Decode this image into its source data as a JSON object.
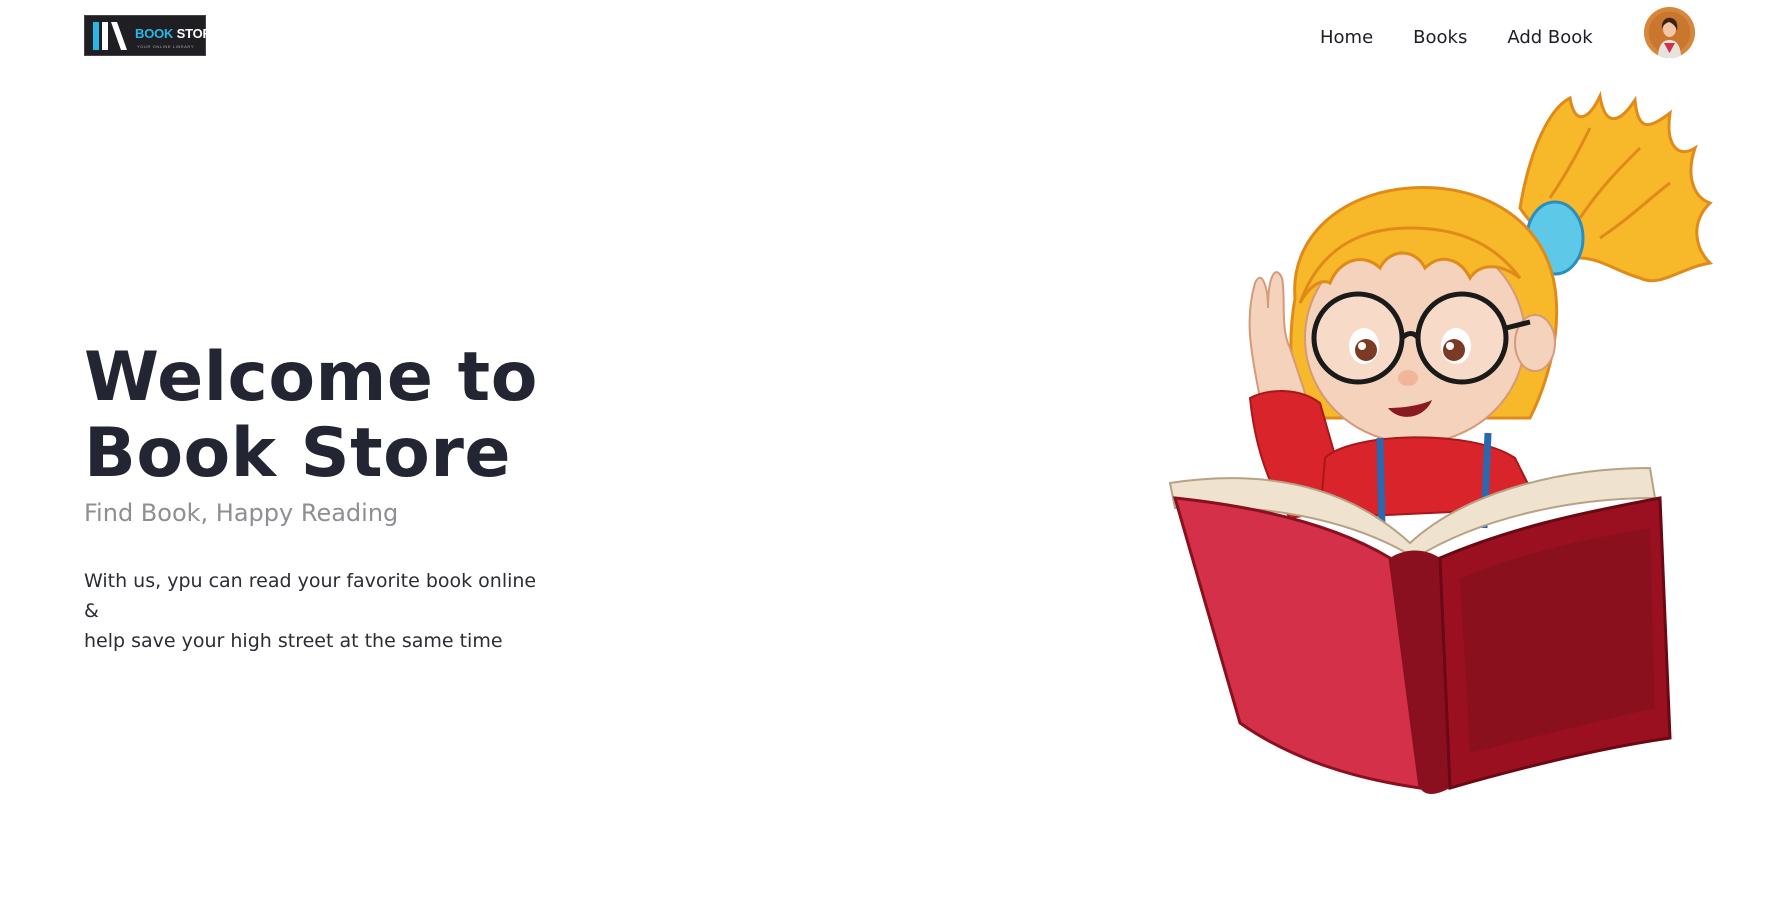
{
  "brand": {
    "logo_text_primary": "BOOK",
    "logo_text_secondary": "STORE",
    "logo_tagline": "YOUR ONLINE LIBRARY",
    "accent_color": "#27b7e6"
  },
  "nav": {
    "links": [
      {
        "label": "Home"
      },
      {
        "label": "Books"
      },
      {
        "label": "Add Book"
      }
    ]
  },
  "user": {
    "avatar_icon": "user-avatar-icon"
  },
  "hero": {
    "title_line1": "Welcome to",
    "title_line2": "Book Store",
    "subtitle": "Find Book, Happy Reading",
    "description_line1": "With us, ypu can read your favorite book online &",
    "description_line2": "help save your high street at the same time"
  },
  "illustration": {
    "icon": "girl-reading-book-illustration",
    "book_color": "#c21f3a",
    "hair_color": "#f7b829"
  }
}
